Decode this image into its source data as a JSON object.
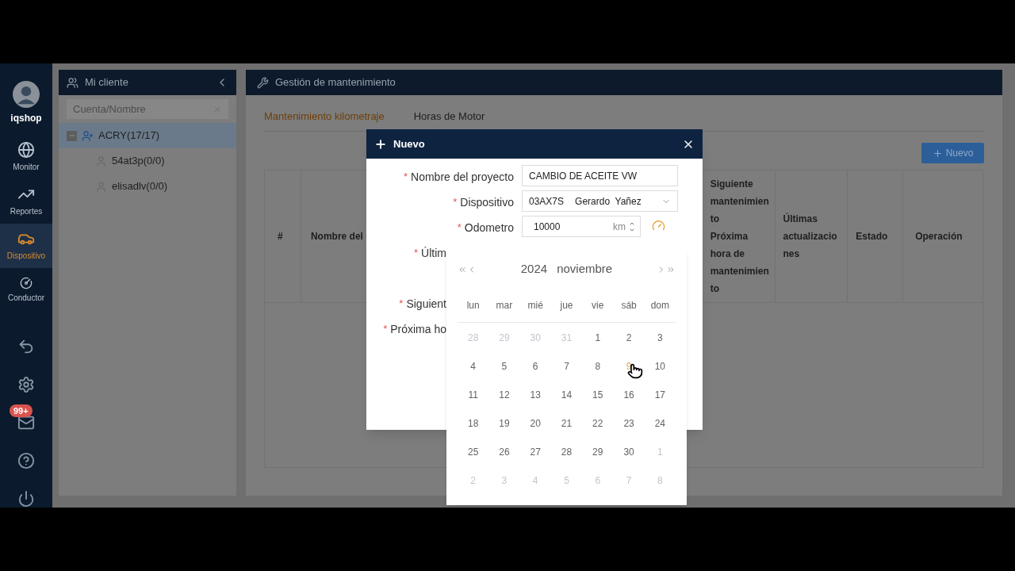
{
  "sidebar": {
    "user": "iqshop",
    "nav": [
      {
        "kind": "globe",
        "label": "Monitor",
        "selected": false
      },
      {
        "kind": "chart",
        "label": "Reportes",
        "selected": false
      },
      {
        "kind": "car",
        "label": "Dispositivo",
        "selected": true
      },
      {
        "kind": "wheel",
        "label": "Conductor",
        "selected": false
      }
    ],
    "tools": [
      {
        "kind": "back"
      },
      {
        "kind": "gear"
      },
      {
        "kind": "mail",
        "badge": "99+"
      },
      {
        "kind": "help"
      },
      {
        "kind": "power"
      }
    ]
  },
  "client_panel": {
    "title": "Mi cliente",
    "search": {
      "placeholder": "Cuenta/Nombre"
    },
    "tree": [
      {
        "label": "ACRY(17/17)",
        "expanded": true,
        "selected": true,
        "children": [
          {
            "label": "54at3p(0/0)",
            "selected": false
          },
          {
            "label": "elisadlv(0/0)",
            "selected": false
          }
        ]
      }
    ]
  },
  "main": {
    "title": "Gestión de mantenimiento",
    "tabs": [
      {
        "label": "Mantenimiento kilometraje",
        "selected": true
      },
      {
        "label": "Horas de Motor",
        "selected": false
      }
    ],
    "new_button": "Nuevo",
    "table": {
      "columns": [
        {
          "lines": [
            "#"
          ]
        },
        {
          "lines": [
            "Nombre del"
          ]
        },
        {
          "lines": [
            "Siguiente mantenimiento",
            "Próxima hora de mantenimiento"
          ]
        },
        {
          "lines": [
            "Últimas actualizaciones"
          ]
        },
        {
          "lines": [
            "Estado"
          ]
        },
        {
          "lines": [
            "Operación"
          ]
        }
      ]
    }
  },
  "modal": {
    "title": "Nuevo",
    "required_mark": "*",
    "fields": [
      {
        "kind": "text",
        "label": "Nombre del proyecto",
        "required": true,
        "value": "CAMBIO DE ACEITE VW"
      },
      {
        "kind": "select",
        "label": "Dispositivo",
        "required": true,
        "value": "03AX7S",
        "detail": "Gerardo  Yañez"
      },
      {
        "kind": "number",
        "label": "Odometro",
        "required": true,
        "value": "10000",
        "unit": "km"
      },
      {
        "kind": "date",
        "label": "Últim",
        "required": true
      },
      {
        "kind": "covered",
        "label": "Siguient",
        "required": true
      },
      {
        "kind": "covered",
        "label": "Próxima ho",
        "required": true
      }
    ]
  },
  "calendar": {
    "year": "2024",
    "month": "noviembre",
    "weekdays": [
      "lun",
      "mar",
      "mié",
      "jue",
      "vie",
      "sáb",
      "dom"
    ],
    "weeks": [
      [
        {
          "day": "28",
          "muted": true
        },
        {
          "day": "29",
          "muted": true
        },
        {
          "day": "30",
          "muted": true
        },
        {
          "day": "31",
          "muted": true
        },
        {
          "day": "1",
          "muted": false
        },
        {
          "day": "2",
          "muted": false
        },
        {
          "day": "3",
          "muted": false
        }
      ],
      [
        {
          "day": "4",
          "muted": false
        },
        {
          "day": "5",
          "muted": false
        },
        {
          "day": "6",
          "muted": false
        },
        {
          "day": "7",
          "muted": false
        },
        {
          "day": "8",
          "muted": false
        },
        {
          "day": "9",
          "muted": false,
          "hovered": true
        },
        {
          "day": "10",
          "muted": false
        }
      ],
      [
        {
          "day": "11",
          "muted": false
        },
        {
          "day": "12",
          "muted": false
        },
        {
          "day": "13",
          "muted": false
        },
        {
          "day": "14",
          "muted": false
        },
        {
          "day": "15",
          "muted": false
        },
        {
          "day": "16",
          "muted": false
        },
        {
          "day": "17",
          "muted": false
        }
      ],
      [
        {
          "day": "18",
          "muted": false
        },
        {
          "day": "19",
          "muted": false
        },
        {
          "day": "20",
          "muted": false
        },
        {
          "day": "21",
          "muted": false
        },
        {
          "day": "22",
          "muted": false
        },
        {
          "day": "23",
          "muted": false
        },
        {
          "day": "24",
          "muted": false
        }
      ],
      [
        {
          "day": "25",
          "muted": false
        },
        {
          "day": "26",
          "muted": false
        },
        {
          "day": "27",
          "muted": false
        },
        {
          "day": "28",
          "muted": false
        },
        {
          "day": "29",
          "muted": false
        },
        {
          "day": "30",
          "muted": false
        },
        {
          "day": "1",
          "muted": true
        }
      ],
      [
        {
          "day": "2",
          "muted": true
        },
        {
          "day": "3",
          "muted": true
        },
        {
          "day": "4",
          "muted": true
        },
        {
          "day": "5",
          "muted": true
        },
        {
          "day": "6",
          "muted": true
        },
        {
          "day": "7",
          "muted": true
        },
        {
          "day": "8",
          "muted": true
        }
      ]
    ]
  }
}
